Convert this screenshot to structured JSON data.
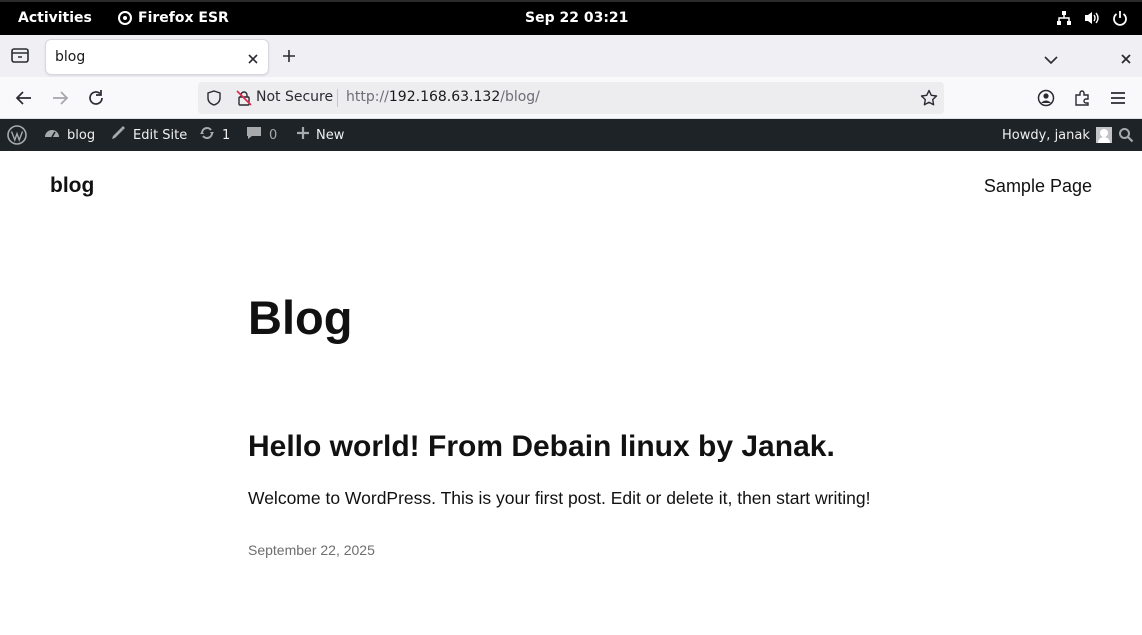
{
  "gnome": {
    "activities": "Activities",
    "app_name": "Firefox ESR",
    "clock": "Sep 22  03:21",
    "tray_icons": [
      "network-icon",
      "volume-icon",
      "power-icon"
    ]
  },
  "browser": {
    "tab": {
      "title": "blog"
    },
    "nav": {
      "security_label": "Not Secure",
      "url_prefix": "http://",
      "url_host": "192.168.63.132",
      "url_path": "/blog/"
    }
  },
  "adminbar": {
    "site_name": "blog",
    "edit_site": "Edit Site",
    "updates_count": "1",
    "comments_count": "0",
    "new_label": "New",
    "howdy": "Howdy, janak",
    "bg_color": "#1d2327"
  },
  "site": {
    "title": "blog",
    "nav_items": [
      "Sample Page"
    ]
  },
  "main": {
    "page_title": "Blog",
    "posts": [
      {
        "title": "Hello world! From Debain linux by Janak.",
        "excerpt": "Welcome to WordPress. This is your first post. Edit or delete it, then start writing!",
        "date": "September 22, 2025"
      }
    ]
  }
}
